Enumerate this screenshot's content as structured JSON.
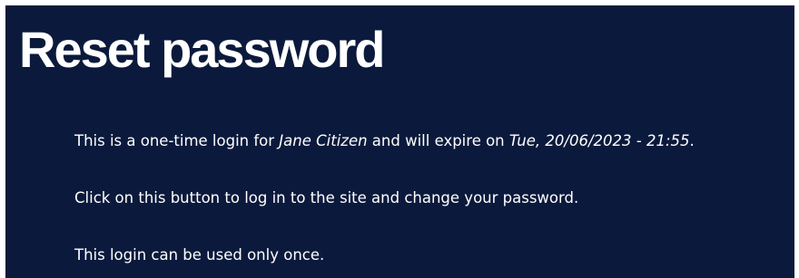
{
  "page": {
    "title": "Reset password"
  },
  "message": {
    "line1": {
      "prefix": "This is a one-time login for ",
      "user_name": "Jane Citizen",
      "middle": " and will expire on ",
      "expiry": "Tue, 20/06/2023 - 21:55",
      "suffix": "."
    },
    "line2": "Click on this button to log in to the site and change your password.",
    "line3": "This login can be used only once."
  },
  "colors": {
    "background": "#0b1a3c",
    "text": "#ffffff"
  }
}
